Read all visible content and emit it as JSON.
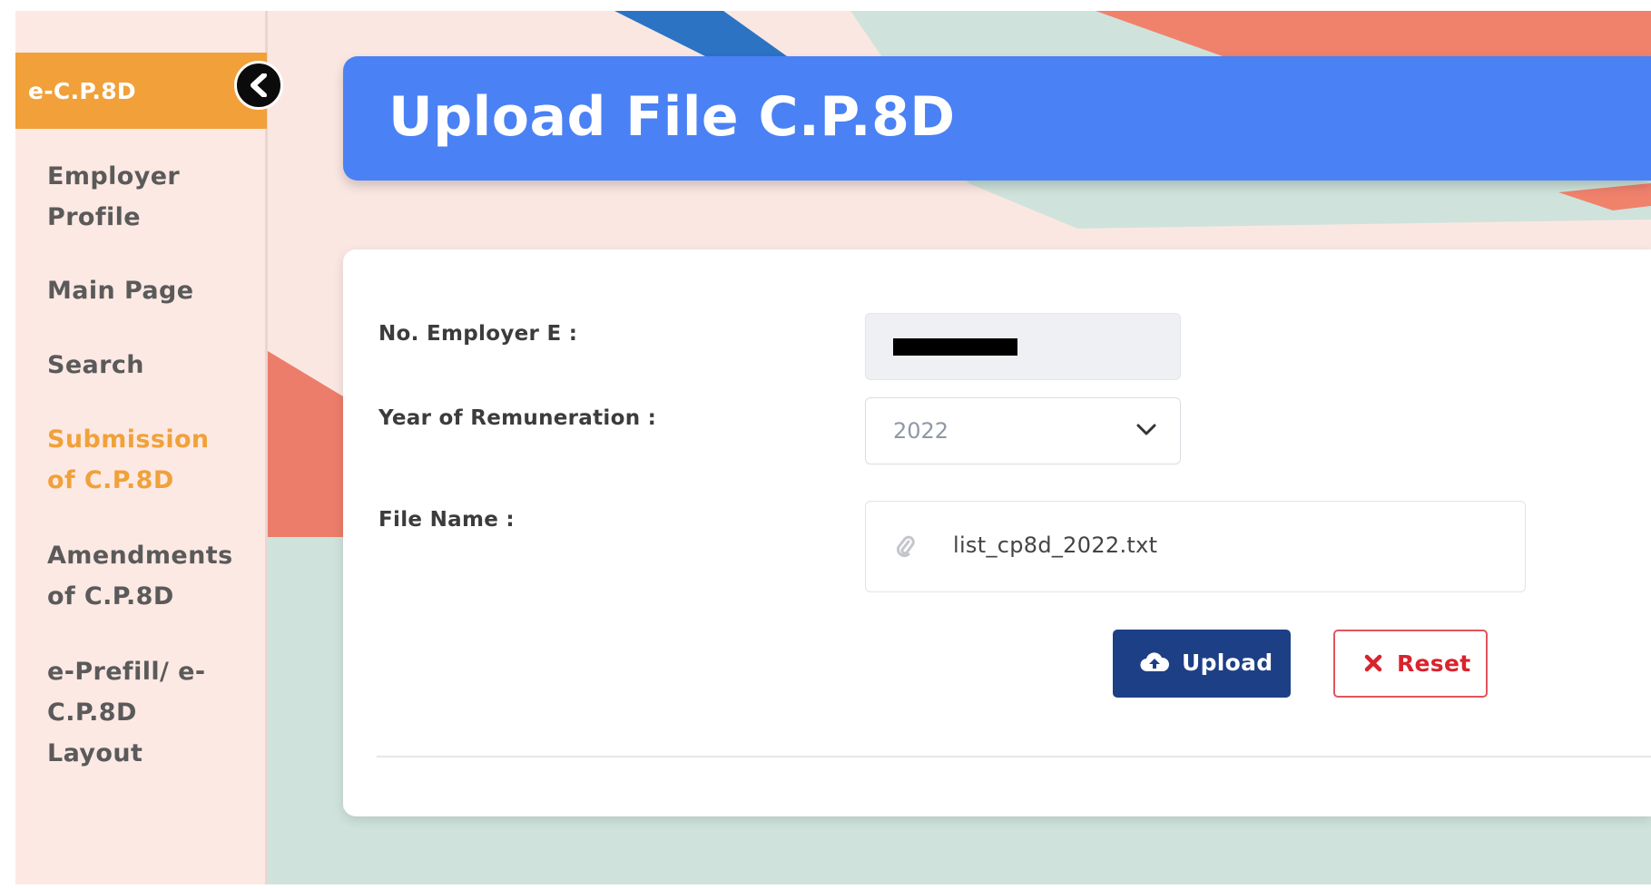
{
  "sidebar": {
    "brand": "e-C.P.8D",
    "items": [
      {
        "label": "Employer Profile",
        "active": false
      },
      {
        "label": "Main Page",
        "active": false
      },
      {
        "label": "Search",
        "active": false
      },
      {
        "label": "Submission of C.P.8D",
        "active": true
      },
      {
        "label": "Amendments of C.P.8D",
        "active": false
      },
      {
        "label": "e-Prefill/ e-C.P.8D Layout",
        "active": false
      }
    ],
    "collapse_icon": "chevron-left-icon"
  },
  "header": {
    "title": "Upload File C.P.8D"
  },
  "form": {
    "employer_no": {
      "label": "No. Employer E :",
      "value_redacted": true
    },
    "year": {
      "label": "Year of Remuneration :",
      "value": "2022"
    },
    "file": {
      "label": "File Name :",
      "value": "list_cp8d_2022.txt",
      "icon": "paperclip-icon"
    },
    "upload_button": {
      "label": "Upload",
      "icon": "cloud-upload-icon"
    },
    "reset_button": {
      "label": "Reset",
      "icon": "x-icon"
    }
  },
  "colors": {
    "accent_orange": "#f2a03a",
    "title_blue": "#4a81f4",
    "upload_navy": "#1d3f86",
    "reset_red": "#d9232d",
    "background_pink": "#fbe7e2"
  }
}
